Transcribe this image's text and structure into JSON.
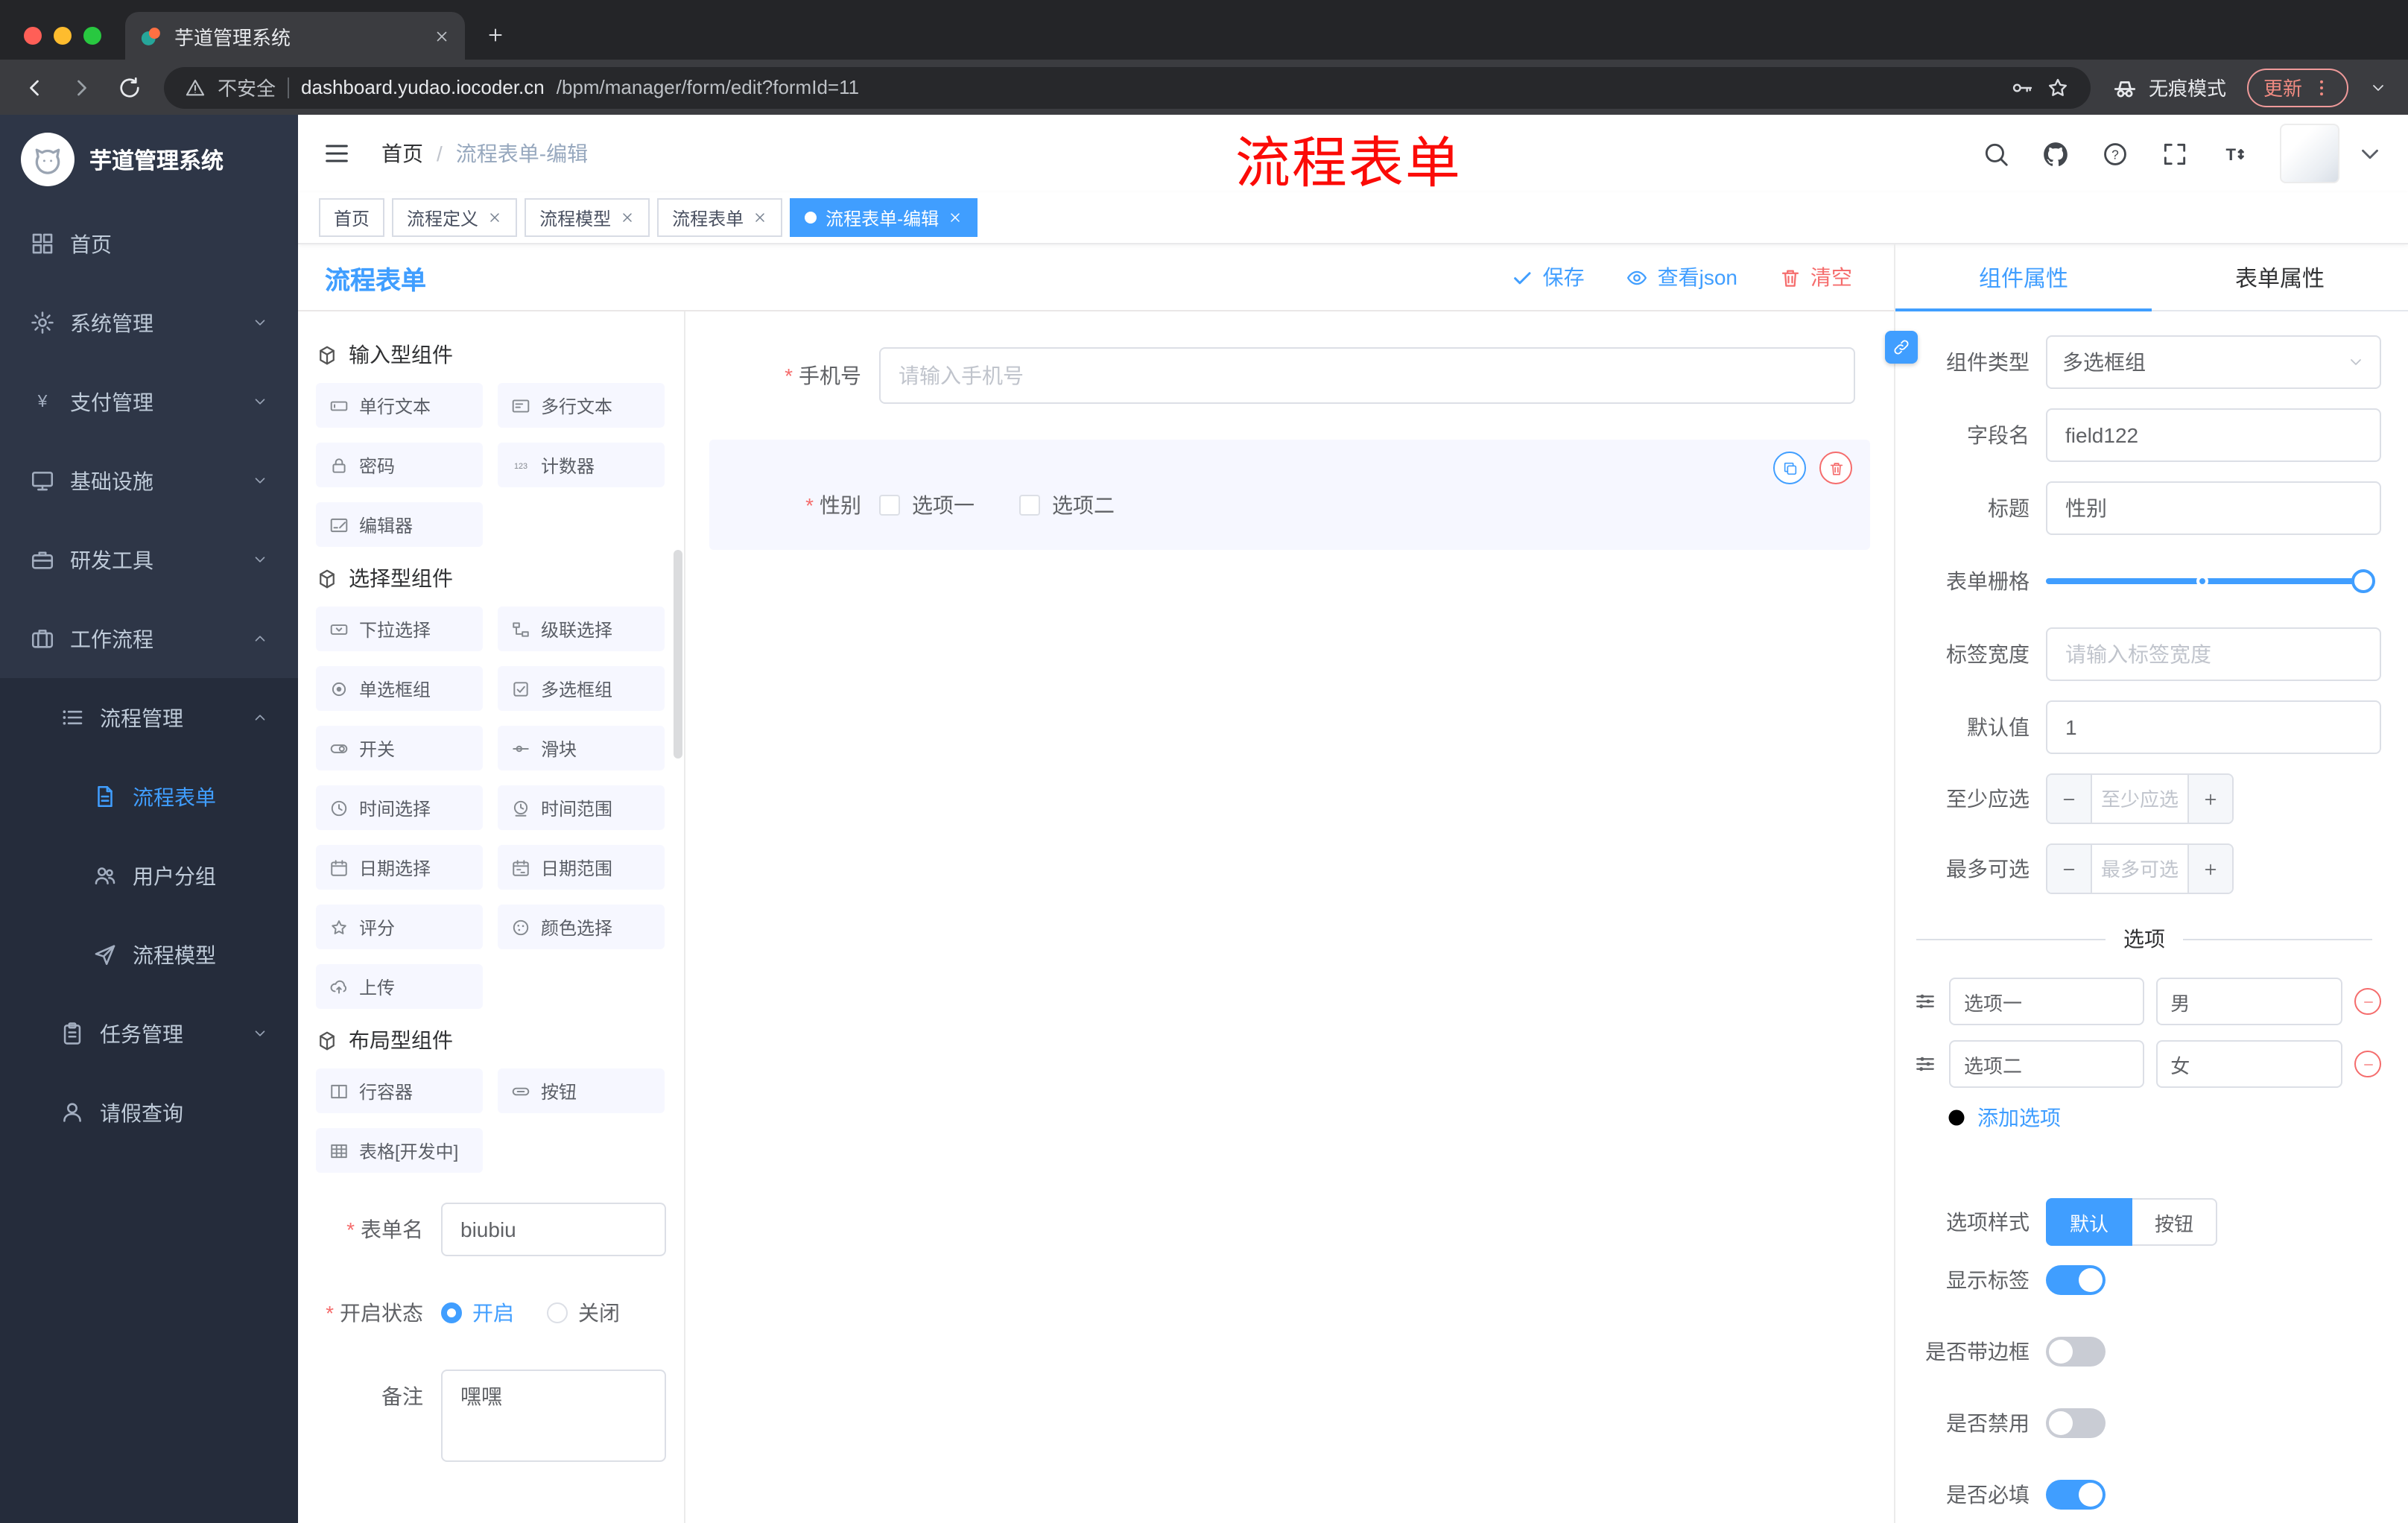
{
  "browser": {
    "tab_title": "芋道管理系统",
    "security_label": "不安全",
    "url_domain": "dashboard.yudao.iocoder.cn",
    "url_path": "/bpm/manager/form/edit?formId=11",
    "incognito_label": "无痕模式",
    "update_label": "更新"
  },
  "sidebar": {
    "logo_title": "芋道管理系统",
    "items": {
      "home": "首页",
      "system": "系统管理",
      "payment": "支付管理",
      "infra": "基础设施",
      "devtools": "研发工具",
      "workflow": "工作流程",
      "process_mgmt": "流程管理",
      "process_form": "流程表单",
      "user_group": "用户分组",
      "process_model": "流程模型",
      "task_mgmt": "任务管理",
      "leave_query": "请假查询"
    }
  },
  "header": {
    "breadcrumb_home": "首页",
    "breadcrumb_sep": "/",
    "breadcrumb_current": "流程表单-编辑",
    "annotation": "流程表单"
  },
  "tags": [
    {
      "label": "首页"
    },
    {
      "label": "流程定义"
    },
    {
      "label": "流程模型"
    },
    {
      "label": "流程表单"
    },
    {
      "label": "流程表单-编辑"
    }
  ],
  "editor": {
    "title": "流程表单",
    "save_label": "保存",
    "view_json_label": "查看json",
    "clear_label": "清空",
    "palette": {
      "sections": [
        {
          "title": "输入型组件",
          "items": [
            {
              "label": "单行文本"
            },
            {
              "label": "多行文本"
            },
            {
              "label": "密码"
            },
            {
              "label": "计数器"
            },
            {
              "label": "编辑器"
            }
          ]
        },
        {
          "title": "选择型组件",
          "items": [
            {
              "label": "下拉选择"
            },
            {
              "label": "级联选择"
            },
            {
              "label": "单选框组"
            },
            {
              "label": "多选框组"
            },
            {
              "label": "开关"
            },
            {
              "label": "滑块"
            },
            {
              "label": "时间选择"
            },
            {
              "label": "时间范围"
            },
            {
              "label": "日期选择"
            },
            {
              "label": "日期范围"
            },
            {
              "label": "评分"
            },
            {
              "label": "颜色选择"
            },
            {
              "label": "上传"
            }
          ]
        },
        {
          "title": "布局型组件",
          "items": [
            {
              "label": "行容器"
            },
            {
              "label": "按钮"
            },
            {
              "label": "表格[开发中]"
            }
          ]
        }
      ]
    },
    "meta": {
      "form_name_label": "表单名",
      "form_name_value": "biubiu",
      "status_label": "开启状态",
      "status_on": "开启",
      "status_off": "关闭",
      "remark_label": "备注",
      "remark_value": "嘿嘿"
    },
    "canvas": {
      "phone_label": "手机号",
      "phone_placeholder": "请输入手机号",
      "gender_label": "性别",
      "gender_options": [
        {
          "label": "选项一"
        },
        {
          "label": "选项二"
        }
      ]
    }
  },
  "props": {
    "tab_component": "组件属性",
    "tab_form": "表单属性",
    "component_type_label": "组件类型",
    "component_type_value": "多选框组",
    "field_name_label": "字段名",
    "field_name_value": "field122",
    "title_label": "标题",
    "title_value": "性别",
    "grid_label": "表单栅格",
    "label_width_label": "标签宽度",
    "label_width_placeholder": "请输入标签宽度",
    "default_label": "默认值",
    "default_value": "1",
    "min_label": "至少应选",
    "min_placeholder": "至少应选",
    "max_label": "最多可选",
    "max_placeholder": "最多可选",
    "options_title": "选项",
    "options": [
      {
        "label": "选项一",
        "value": "男"
      },
      {
        "label": "选项二",
        "value": "女"
      }
    ],
    "add_option_label": "添加选项",
    "option_style_label": "选项样式",
    "style_default": "默认",
    "style_button": "按钮",
    "switches": [
      {
        "label": "显示标签",
        "on": true
      },
      {
        "label": "是否带边框",
        "on": false
      },
      {
        "label": "是否禁用",
        "on": false
      },
      {
        "label": "是否必填",
        "on": true
      }
    ],
    "accent_color": "#409EFF",
    "danger_color": "#F56C6C"
  }
}
